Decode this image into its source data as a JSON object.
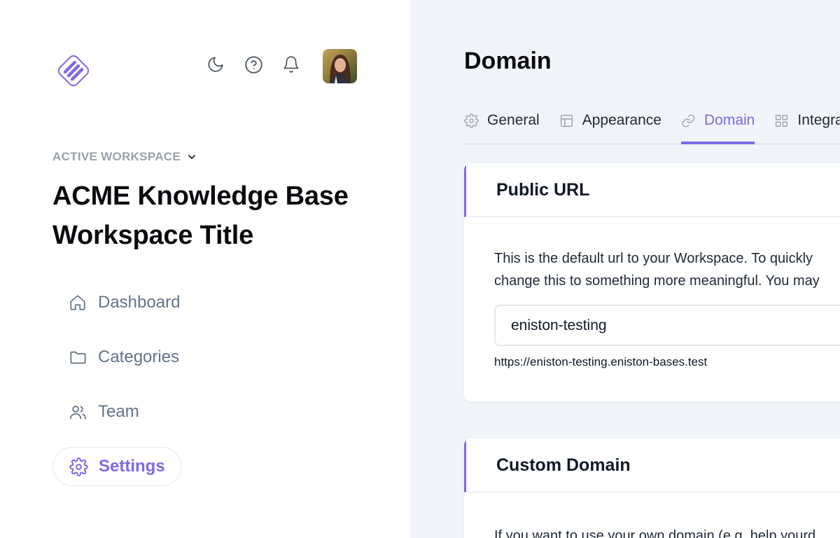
{
  "header": {
    "icons": [
      "moon-icon",
      "help-circle-icon",
      "bell-icon"
    ],
    "avatar": "user-avatar"
  },
  "workspace": {
    "label": "ACTIVE WORKSPACE",
    "title": "ACME Knowledge Base Workspace Title"
  },
  "nav": {
    "items": [
      {
        "label": "Dashboard",
        "icon": "home-icon"
      },
      {
        "label": "Categories",
        "icon": "folder-icon"
      },
      {
        "label": "Team",
        "icon": "users-icon"
      },
      {
        "label": "Settings",
        "icon": "gear-icon",
        "active": true
      }
    ]
  },
  "main": {
    "title": "Domain",
    "tabs": [
      {
        "label": "General",
        "icon": "gear-icon"
      },
      {
        "label": "Appearance",
        "icon": "layout-icon"
      },
      {
        "label": "Domain",
        "icon": "link-icon",
        "active": true
      },
      {
        "label": "Integra",
        "icon": "grid-icon"
      }
    ],
    "public_url": {
      "heading": "Public URL",
      "desc_line1": "This is the default url to your Workspace. To quickly",
      "desc_line2": "change this to something more meaningful. You may",
      "input_value": "eniston-testing",
      "full_url": "https://eniston-testing.eniston-bases.test"
    },
    "custom_domain": {
      "heading": "Custom Domain",
      "desc": "If you want to use your own domain (e.g. help.yourd"
    }
  },
  "colors": {
    "accent": "#7c6ae6",
    "sidebar_bg": "#ffffff",
    "main_bg": "#f1f4f9",
    "muted_text": "#64748b"
  }
}
